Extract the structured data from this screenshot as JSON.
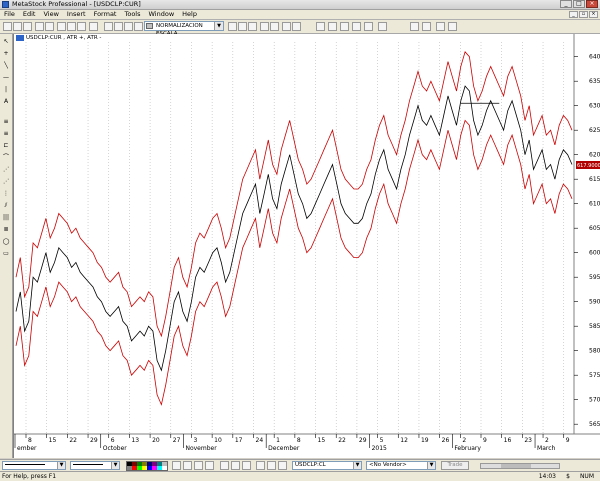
{
  "window": {
    "title": "MetaStock Professional - [USDCLP:CUR]"
  },
  "menu": [
    "File",
    "Edit",
    "View",
    "Insert",
    "Format",
    "Tools",
    "Window",
    "Help"
  ],
  "toolbar": {
    "normalization_combo": "NORMALIZACION ESCALA"
  },
  "chart": {
    "title": "USDCLP:CUR , ATR +, ATR -",
    "last_value_label": "617.9000",
    "y_axis": {
      "ticks": [
        565,
        570,
        575,
        580,
        585,
        590,
        595,
        600,
        605,
        610,
        615,
        620,
        625,
        630,
        635,
        640
      ],
      "range": [
        563,
        643
      ]
    },
    "x_axis": {
      "ticks": [
        "8",
        "15",
        "22",
        "29",
        "6",
        "13",
        "20",
        "27",
        "3",
        "10",
        "17",
        "24",
        "1",
        "8",
        "15",
        "22",
        "29",
        "5",
        "12",
        "19",
        "26",
        "2",
        "9",
        "16",
        "23",
        "2",
        "9"
      ],
      "months": [
        "ember",
        "October",
        "November",
        "December",
        "2015",
        "February",
        "March"
      ]
    }
  },
  "chart_data": {
    "type": "line",
    "x_unit": "trading session",
    "ylim": [
      563,
      643
    ],
    "series": [
      {
        "name": "USDCLP:CUR",
        "color": "#000000",
        "values": [
          588,
          592,
          584,
          586,
          595,
          594,
          597,
          600,
          596,
          598,
          601,
          600,
          599,
          597,
          598,
          596,
          595,
          594,
          593,
          591,
          590,
          588,
          587,
          588,
          589,
          586,
          585,
          582,
          583,
          584,
          583,
          585,
          584,
          578,
          576,
          580,
          585,
          590,
          592,
          588,
          586,
          590,
          595,
          597,
          596,
          598,
          600,
          601,
          598,
          594,
          596,
          600,
          604,
          608,
          610,
          612,
          614,
          608,
          612,
          616,
          611,
          609,
          614,
          617,
          620,
          616,
          612,
          610,
          607,
          608,
          610,
          612,
          614,
          616,
          618,
          614,
          610,
          608,
          607,
          606,
          606,
          607,
          610,
          612,
          616,
          619,
          621,
          617,
          615,
          613,
          617,
          620,
          624,
          627,
          630,
          627,
          626,
          628,
          626,
          624,
          628,
          632,
          629,
          626,
          631,
          634,
          633,
          627,
          624,
          626,
          629,
          631,
          629,
          627,
          625,
          629,
          631,
          628,
          625,
          620,
          623,
          617,
          619,
          621,
          617,
          618,
          615,
          619,
          621,
          620,
          618
        ]
      },
      {
        "name": "ATR +",
        "color": "#cc0000",
        "values": [
          595,
          599,
          591,
          593,
          602,
          601,
          604,
          607,
          603,
          605,
          608,
          607,
          606,
          604,
          605,
          603,
          602,
          601,
          600,
          598,
          597,
          595,
          594,
          595,
          596,
          593,
          592,
          589,
          590,
          591,
          590,
          592,
          591,
          585,
          583,
          587,
          592,
          597,
          599,
          595,
          593,
          597,
          602,
          604,
          603,
          605,
          607,
          608,
          605,
          601,
          603,
          607,
          611,
          615,
          617,
          619,
          621,
          615,
          619,
          623,
          618,
          616,
          621,
          624,
          627,
          623,
          619,
          617,
          614,
          615,
          617,
          619,
          621,
          623,
          625,
          621,
          617,
          615,
          614,
          613,
          613,
          614,
          617,
          619,
          623,
          626,
          628,
          624,
          622,
          620,
          624,
          627,
          631,
          634,
          637,
          634,
          633,
          635,
          633,
          631,
          635,
          639,
          636,
          633,
          638,
          641,
          640,
          634,
          631,
          633,
          636,
          638,
          636,
          634,
          632,
          636,
          638,
          635,
          632,
          627,
          630,
          624,
          626,
          628,
          624,
          625,
          622,
          626,
          628,
          627,
          625
        ]
      },
      {
        "name": "ATR -",
        "color": "#cc0000",
        "values": [
          581,
          585,
          577,
          579,
          588,
          587,
          590,
          593,
          589,
          591,
          594,
          593,
          592,
          590,
          591,
          589,
          588,
          587,
          586,
          584,
          583,
          581,
          580,
          581,
          582,
          579,
          578,
          575,
          576,
          577,
          576,
          578,
          577,
          571,
          569,
          573,
          578,
          583,
          585,
          581,
          579,
          583,
          588,
          590,
          589,
          591,
          593,
          594,
          591,
          587,
          589,
          593,
          597,
          601,
          603,
          605,
          607,
          601,
          605,
          609,
          604,
          602,
          607,
          610,
          613,
          609,
          605,
          603,
          600,
          601,
          603,
          605,
          607,
          609,
          611,
          607,
          603,
          601,
          600,
          599,
          599,
          600,
          603,
          605,
          609,
          612,
          614,
          610,
          608,
          606,
          610,
          613,
          617,
          620,
          623,
          620,
          619,
          621,
          619,
          617,
          621,
          625,
          622,
          619,
          624,
          627,
          626,
          620,
          617,
          619,
          622,
          624,
          622,
          620,
          618,
          622,
          624,
          621,
          618,
          613,
          616,
          610,
          612,
          614,
          610,
          611,
          608,
          612,
          614,
          613,
          611
        ]
      }
    ]
  },
  "bottom_toolbar": {
    "symbol": "USDCLP:CL",
    "vendor": "<No Vendor>",
    "trade": "Trade"
  },
  "status": {
    "help": "For Help, press F1",
    "clock": "14:03",
    "dollar": "$",
    "num": "NUM"
  }
}
